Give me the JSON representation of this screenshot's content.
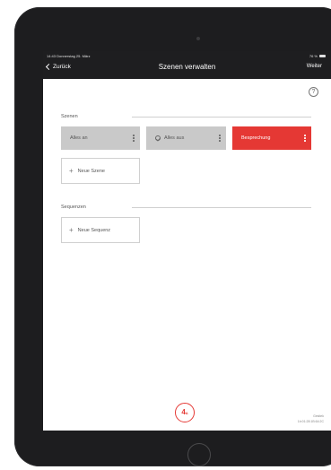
{
  "status": {
    "time": "14:43  Donnerstag 25. März",
    "battery": "76 %"
  },
  "nav": {
    "back_label": "Zurück",
    "title": "Szenen verwalten",
    "next_label": "Weiter"
  },
  "help": {
    "symbol": "?"
  },
  "scenes_section": {
    "label": "Szenen",
    "tiles": [
      {
        "label": "Alles an",
        "state": "gray"
      },
      {
        "label": "Alles aus",
        "state": "gray"
      },
      {
        "label": "Besprechung",
        "state": "red"
      }
    ],
    "add_label": "Neue Szene"
  },
  "sequences_section": {
    "label": "Sequenzen",
    "add_label": "Neue Sequenz"
  },
  "logo": {
    "main": "4",
    "sub": "A"
  },
  "version": {
    "line1": "Gesitek",
    "line2": "1b:01:28:1B:64:2C"
  },
  "colors": {
    "accent": "#e53834",
    "tile_gray": "#c9c9c9",
    "topbar": "#1e1e20"
  }
}
